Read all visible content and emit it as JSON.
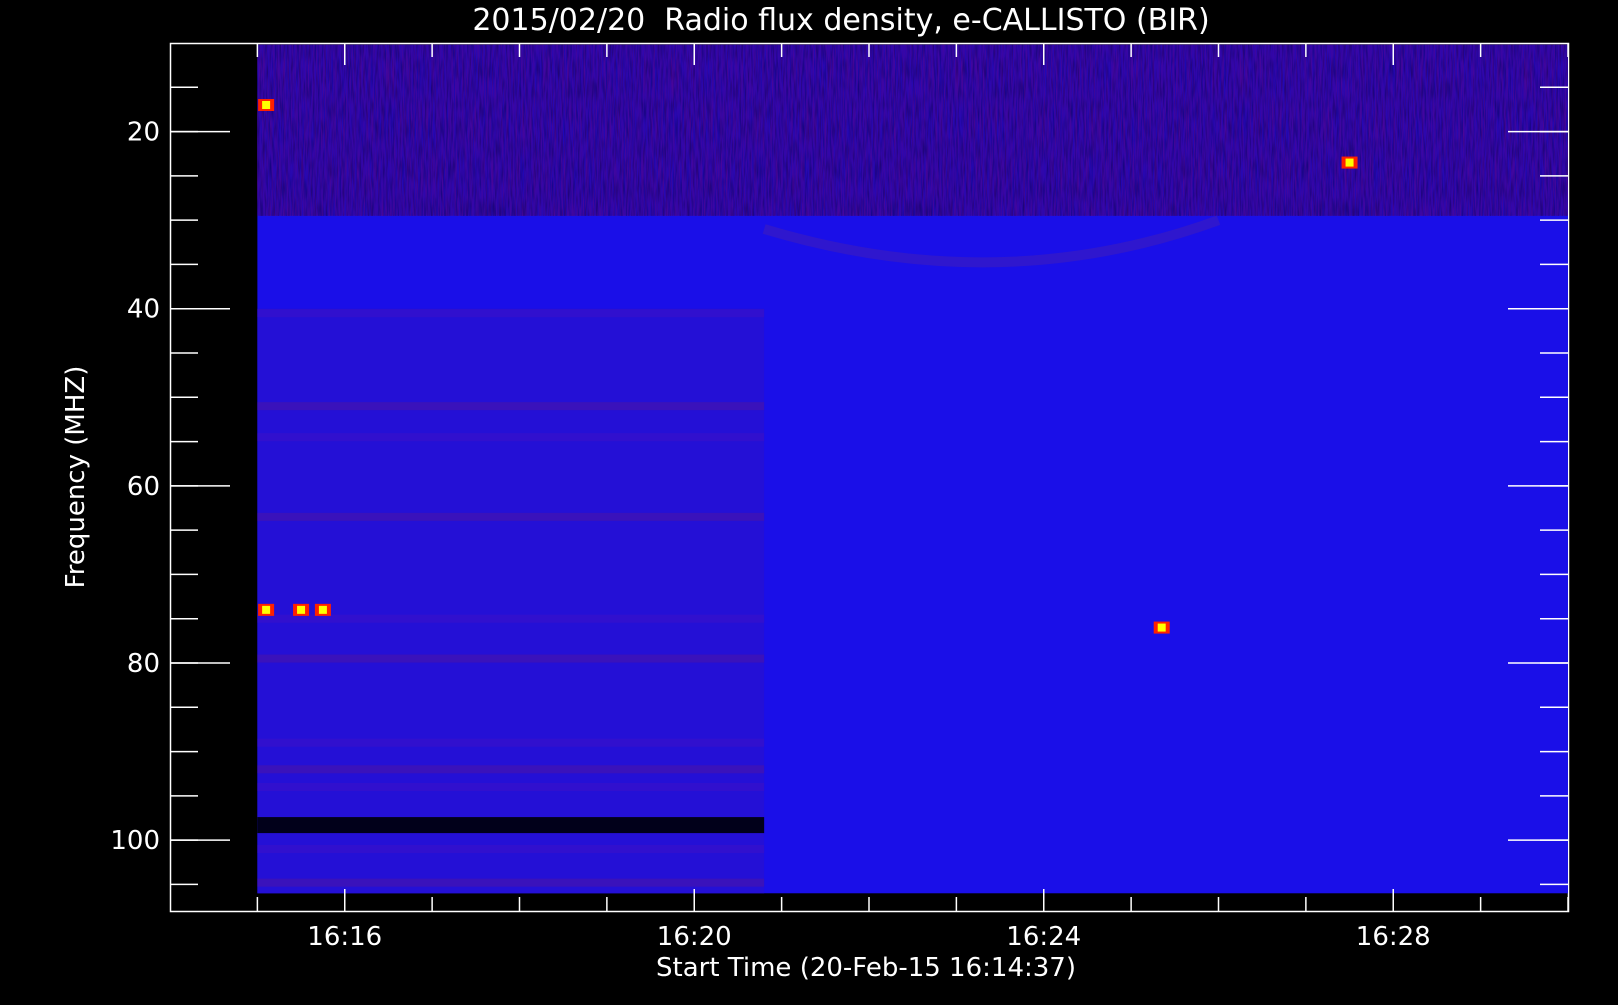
{
  "chart_data": {
    "type": "heatmap",
    "title": "2015/02/20  Radio flux density, e-CALLISTO (BIR)",
    "xlabel": "Start Time (20-Feb-15 16:14:37)",
    "ylabel": "Frequency (MHZ)",
    "x_tick_labels": [
      "16:16",
      "16:20",
      "16:24",
      "16:28"
    ],
    "x_tick_values_min": [
      16.0,
      20.0,
      24.0,
      28.0
    ],
    "y_tick_labels": [
      "20",
      "40",
      "60",
      "80",
      "100"
    ],
    "y_tick_values": [
      20,
      40,
      60,
      80,
      100
    ],
    "xlim_min": [
      14.0,
      30.0
    ],
    "data_xlim_min": [
      15.0,
      30.0
    ],
    "ylim": [
      10,
      108
    ],
    "data_ylim": [
      10.2,
      106
    ],
    "y_inverted": true,
    "colormap": [
      "#000000",
      "#0000ff",
      "#8b0000",
      "#ff0000",
      "#ffff00"
    ],
    "background_color": "#000000",
    "frame_color": "#ffffff",
    "receiver_switch_min": 20.8,
    "high_flux_band_mhz": [
      10.2,
      29.5
    ],
    "rfi_bands_mhz": [
      40.5,
      51,
      54.5,
      63.5,
      75,
      79.5,
      89,
      92,
      94,
      98.3,
      101,
      104.8
    ],
    "hot_spots": [
      {
        "t_min": 15.1,
        "f_mhz": 74.0
      },
      {
        "t_min": 15.5,
        "f_mhz": 74.0
      },
      {
        "t_min": 15.75,
        "f_mhz": 74.0
      },
      {
        "t_min": 25.35,
        "f_mhz": 76.0
      },
      {
        "t_min": 27.5,
        "f_mhz": 23.5
      },
      {
        "t_min": 15.1,
        "f_mhz": 17.0
      }
    ]
  }
}
